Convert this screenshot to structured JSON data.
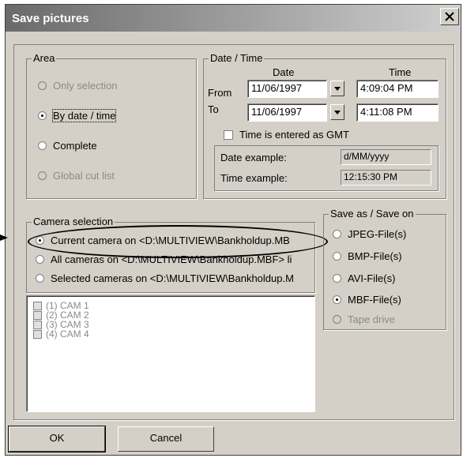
{
  "window": {
    "title": "Save pictures"
  },
  "area": {
    "label": "Area",
    "options": [
      {
        "label": "Only selection",
        "selected": false,
        "enabled": false
      },
      {
        "label": "By date / time",
        "selected": true,
        "enabled": true
      },
      {
        "label": "Complete",
        "selected": false,
        "enabled": true
      },
      {
        "label": "Global cut list",
        "selected": false,
        "enabled": false
      }
    ]
  },
  "datetime": {
    "label": "Date / Time",
    "date_header": "Date",
    "time_header": "Time",
    "from_label": "From",
    "to_label": "To",
    "from_date": "11/06/1997",
    "from_time": "4:09:04 PM",
    "to_date": "11/06/1997",
    "to_time": "4:11:08 PM",
    "gmt_label": "Time is entered as GMT",
    "gmt_checked": false,
    "date_example_label": "Date example:",
    "date_example_value": "d/MM/yyyy",
    "time_example_label": "Time example:",
    "time_example_value": "12:15:30 PM"
  },
  "camera": {
    "label": "Camera selection",
    "options": [
      {
        "label": "Current camera on <D:\\MULTIVIEW\\Bankholdup.MB",
        "selected": true
      },
      {
        "label": "All cameras on <D:\\MULTIVIEW\\Bankholdup.MBF> li",
        "selected": false
      },
      {
        "label": "Selected cameras on <D:\\MULTIVIEW\\Bankholdup.M",
        "selected": false
      }
    ],
    "list": [
      "(1) CAM 1",
      "(2) CAM 2",
      "(3) CAM 3",
      "(4) CAM 4"
    ]
  },
  "saveas": {
    "label": "Save as / Save on",
    "options": [
      {
        "label": "JPEG-File(s)",
        "selected": false,
        "enabled": true
      },
      {
        "label": "BMP-File(s)",
        "selected": false,
        "enabled": true
      },
      {
        "label": "AVI-File(s)",
        "selected": false,
        "enabled": true
      },
      {
        "label": "MBF-File(s)",
        "selected": true,
        "enabled": true
      },
      {
        "label": "Tape drive",
        "selected": false,
        "enabled": false
      }
    ]
  },
  "buttons": {
    "ok": "OK",
    "cancel": "Cancel"
  }
}
